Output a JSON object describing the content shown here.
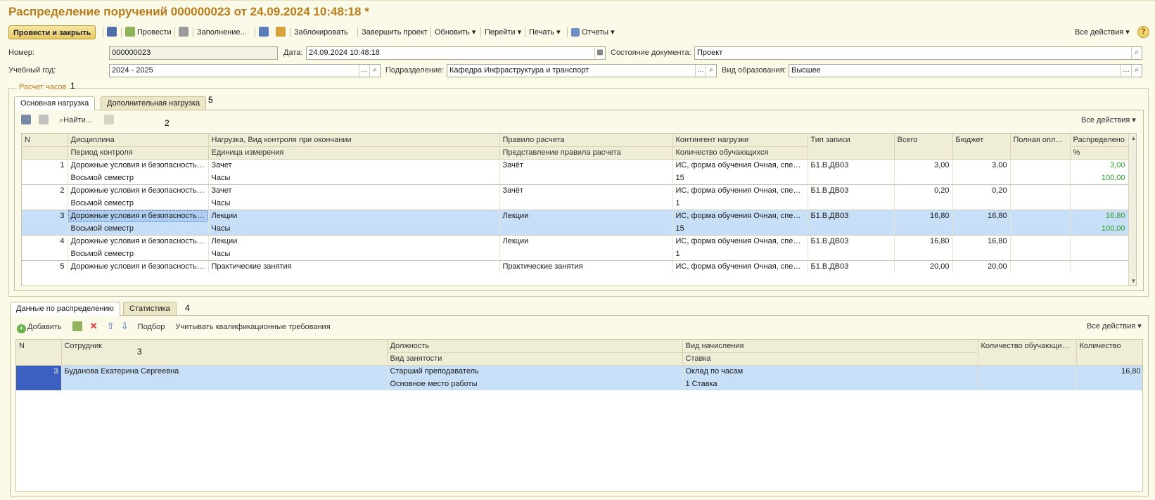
{
  "window": {
    "title": "Распределение поручений 000000023 от 24.09.2024 10:48:18 *"
  },
  "toolbar": {
    "post_close": "Провести и закрыть",
    "post": "Провести",
    "fill": "Заполнение...",
    "lock": "Заблокировать",
    "finish": "Завершить проект",
    "refresh": "Обновить",
    "goto": "Перейти",
    "print": "Печать",
    "reports": "Отчеты",
    "all_actions": "Все действия",
    "help": "?"
  },
  "form": {
    "number_label": "Номер:",
    "number_value": "000000023",
    "date_label": "Дата:",
    "date_value": "24.09.2024 10:48:18",
    "state_label": "Состояние документа:",
    "state_value": "Проект",
    "year_label": "Учебный год:",
    "year_value": "2024 - 2025",
    "dept_label": "Подразделение:",
    "dept_value": "Кафедра Инфраструктура и транспорт",
    "edu_label": "Вид образования:",
    "edu_value": "Высшее"
  },
  "hours_group": {
    "title": "Расчет часов",
    "tabs": [
      "Основная нагрузка",
      "Дополнительная нагрузка"
    ],
    "find": "Найти...",
    "all_actions": "Все действия",
    "headers_top": [
      "N",
      "Дисциплина",
      "Нагрузка, Вид контроля при окончании",
      "Правило расчета",
      "Контингент нагрузки",
      "Тип записи",
      "Всего",
      "Бюджет",
      "Полная оплата",
      "Распределено"
    ],
    "headers_bottom": [
      "Период контроля",
      "Единица измерения",
      "Представление правила расчета",
      "Количество обучающихся",
      "%"
    ],
    "rows": [
      {
        "n": "1",
        "discipline": "Дорожные условия и безопасность ...",
        "load": "Зачет",
        "rule": "Зачёт",
        "contingent": "ИС, форма обучения Очная, специ...",
        "type": "Б1.В.ДВ03",
        "total": "3,00",
        "budget": "3,00",
        "full": "",
        "dist": "3,00",
        "period": "Восьмой семестр",
        "unit": "Часы",
        "rule_view": "",
        "students": "15",
        "pct": "100,00"
      },
      {
        "n": "2",
        "discipline": "Дорожные условия и безопасность ...",
        "load": "Зачет",
        "rule": "Зачёт",
        "contingent": "ИС, форма обучения Очная, специ...",
        "type": "Б1.В.ДВ03",
        "total": "0,20",
        "budget": "0,20",
        "full": "",
        "dist": "",
        "period": "Восьмой семестр",
        "unit": "Часы",
        "rule_view": "",
        "students": "1",
        "pct": ""
      },
      {
        "n": "3",
        "discipline": "Дорожные условия и безопасность ...",
        "load": "Лекции",
        "rule": "Лекции",
        "contingent": "ИС, форма обучения Очная, специ...",
        "type": "Б1.В.ДВ03",
        "total": "16,80",
        "budget": "16,80",
        "full": "",
        "dist": "16,80",
        "period": "Восьмой семестр",
        "unit": "Часы",
        "rule_view": "",
        "students": "15",
        "pct": "100,00"
      },
      {
        "n": "4",
        "discipline": "Дорожные условия и безопасность ...",
        "load": "Лекции",
        "rule": "Лекции",
        "contingent": "ИС, форма обучения Очная, специ...",
        "type": "Б1.В.ДВ03",
        "total": "16,80",
        "budget": "16,80",
        "full": "",
        "dist": "",
        "period": "Восьмой семестр",
        "unit": "Часы",
        "rule_view": "",
        "students": "1",
        "pct": ""
      },
      {
        "n": "5",
        "discipline": "Дорожные условия и безопасность ...",
        "load": "Практические занятия",
        "rule": "Практические занятия",
        "contingent": "ИС, форма обучения Очная, специ...",
        "type": "Б1.В.ДВ03",
        "total": "20,00",
        "budget": "20,00",
        "full": "",
        "dist": ""
      }
    ]
  },
  "dist_group": {
    "tabs": [
      "Данные по распределению",
      "Статистика"
    ],
    "add": "Добавить",
    "pick": "Подбор",
    "qual": "Учитывать квалификационные требования",
    "all_actions": "Все действия",
    "headers_top": [
      "N",
      "Сотрудник",
      "Должность",
      "Вид начисления",
      "Количество обучающихся",
      "Количество"
    ],
    "headers_bottom": [
      "Вид занятости",
      "Ставка"
    ],
    "rows": [
      {
        "n": "3",
        "employee": "Буданова Екатерина Сергеевна",
        "position": "Старший преподаватель",
        "accrual": "Оклад по часам",
        "employment": "Основное место работы",
        "rate": "1 Ставка",
        "students": "",
        "qty": "16,80"
      }
    ]
  },
  "annotations": [
    "1",
    "2",
    "3",
    "4",
    "5"
  ]
}
